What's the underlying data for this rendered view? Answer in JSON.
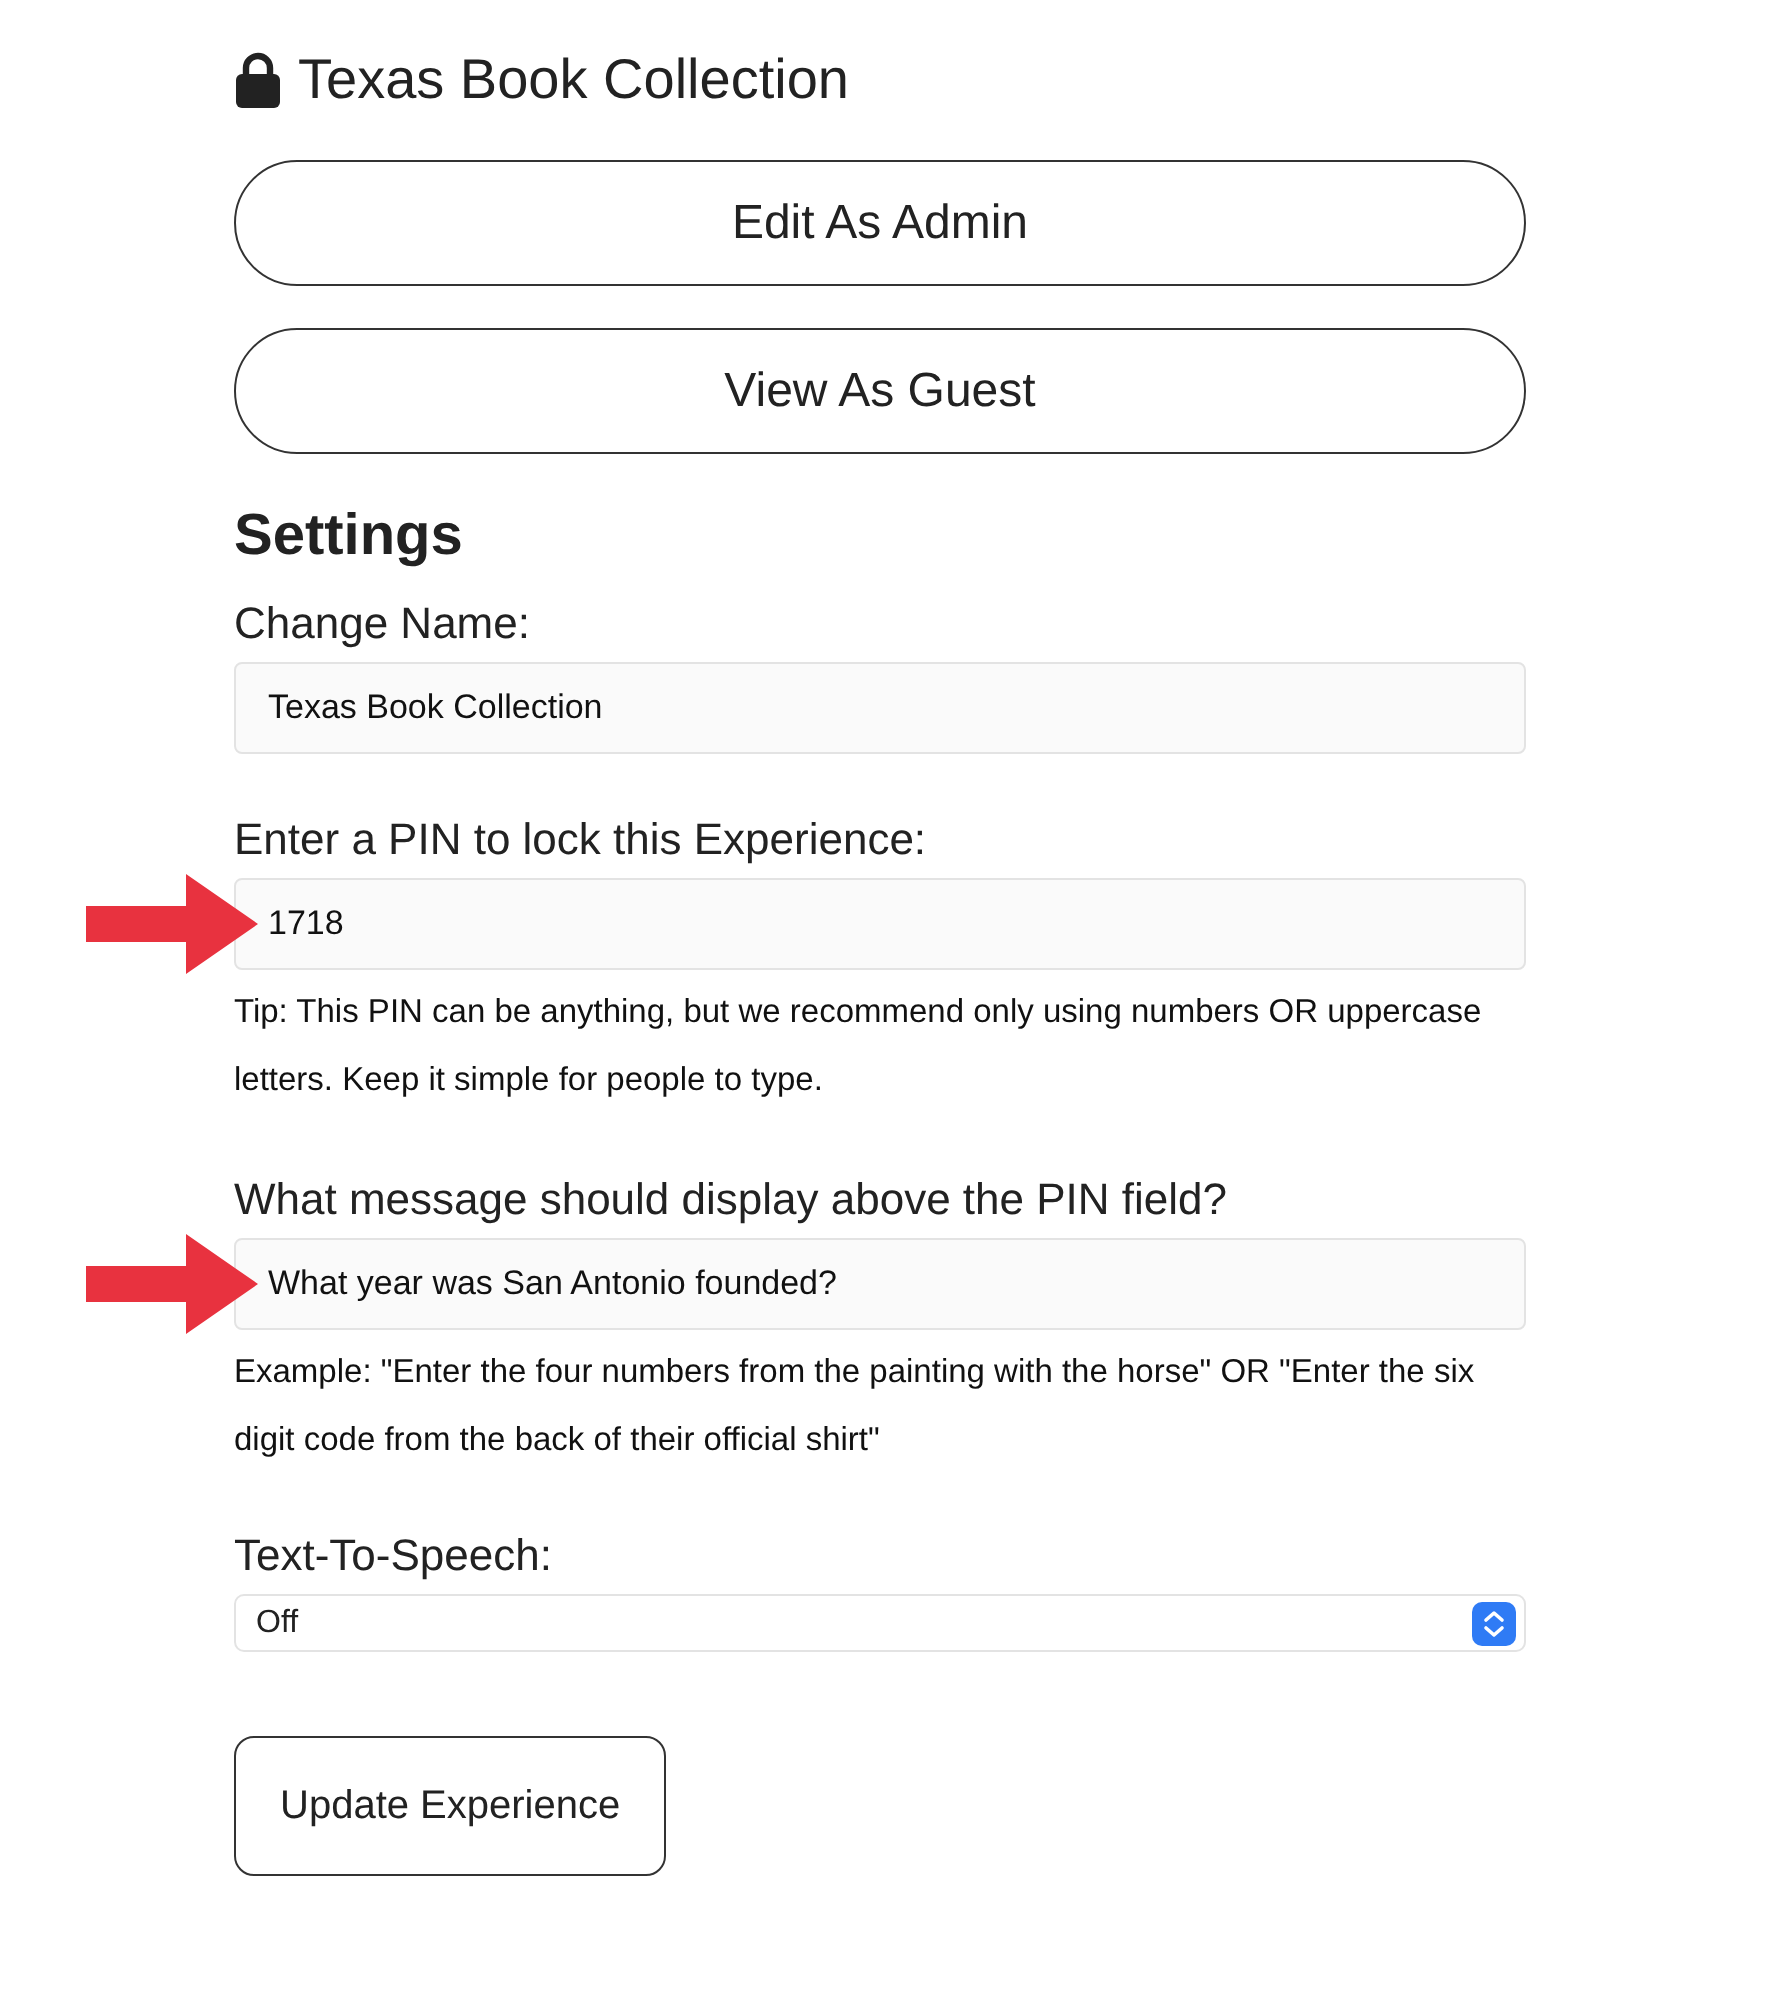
{
  "title": "Texas Book Collection",
  "buttons": [
    {
      "label": "Edit As Admin"
    },
    {
      "label": "View As Guest"
    }
  ],
  "settings": {
    "heading": "Settings",
    "fields": [
      {
        "label": "Change Name:",
        "value": "Texas Book Collection",
        "pointer": false
      },
      {
        "label": "Enter a PIN to lock this Experience:",
        "value": "1718",
        "pointer": true,
        "help": "Tip: This PIN can be anything, but we recommend only using numbers OR uppercase letters. Keep it simple for people to type."
      },
      {
        "label": "What message should display above the PIN field?",
        "value": "What year was San Antonio founded?",
        "pointer": true,
        "help": "Example: \"Enter the four numbers from the painting with the horse\" OR \"Enter the six digit code from the back of their official shirt\""
      }
    ],
    "text_to_speech": {
      "label": "Text-To-Speech:",
      "value": "Off"
    },
    "submit": "Update Experience"
  }
}
